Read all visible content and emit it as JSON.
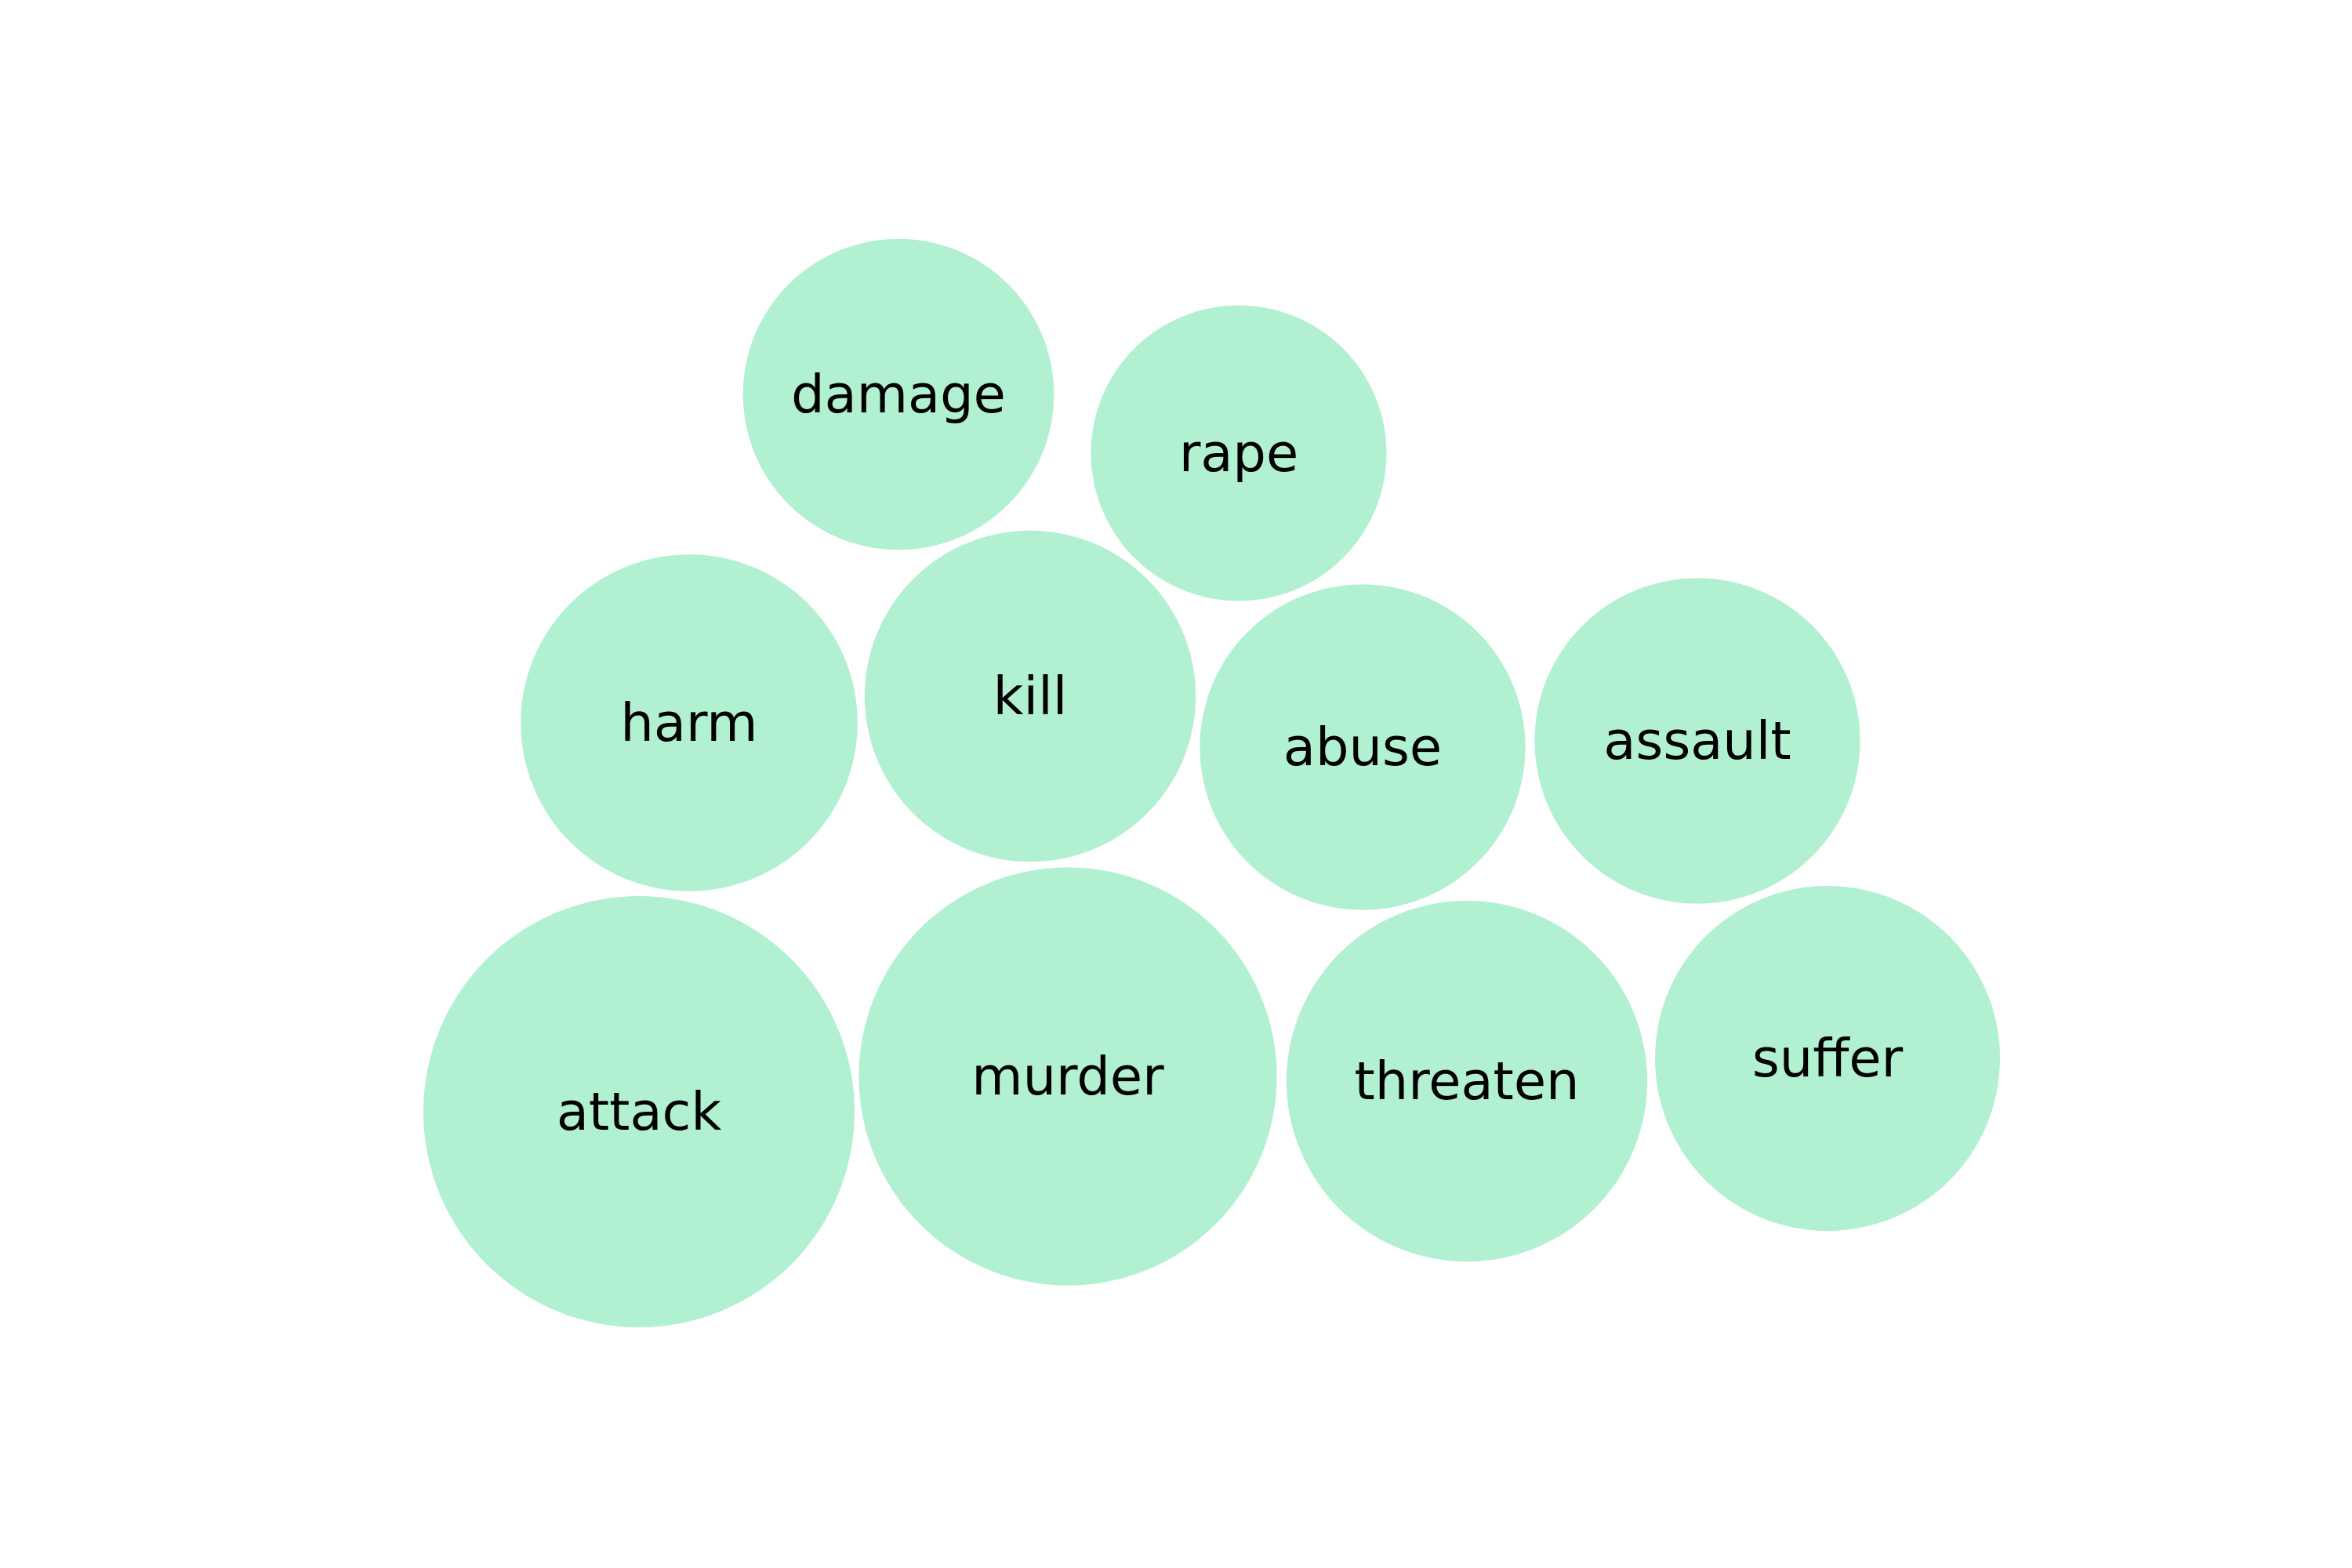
{
  "chart_data": {
    "type": "bubble",
    "title": "",
    "bubble_color": "#b1f0d0",
    "label_color": "#000000",
    "series": [
      {
        "values": [
          {
            "label": "attack",
            "size": 1.0
          },
          {
            "label": "murder",
            "size": 0.94
          },
          {
            "label": "threaten",
            "size": 0.7
          },
          {
            "label": "suffer",
            "size": 0.64
          },
          {
            "label": "harm",
            "size": 0.61
          },
          {
            "label": "kill",
            "size": 0.59
          },
          {
            "label": "abuse",
            "size": 0.57
          },
          {
            "label": "assault",
            "size": 0.57
          },
          {
            "label": "damage",
            "size": 0.52
          },
          {
            "label": "rape",
            "size": 0.47
          }
        ]
      }
    ]
  }
}
